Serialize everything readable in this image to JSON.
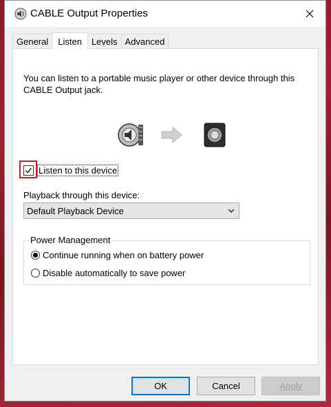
{
  "window": {
    "title": "CABLE Output Properties",
    "icon": "speaker-icon"
  },
  "tabs": [
    {
      "label": "General",
      "active": false
    },
    {
      "label": "Listen",
      "active": true
    },
    {
      "label": "Levels",
      "active": false
    },
    {
      "label": "Advanced",
      "active": false
    }
  ],
  "listen": {
    "description": "You can listen to a portable music player or other device through this CABLE Output jack.",
    "listen_checkbox_label": "Listen to this device",
    "listen_checked": true,
    "playback_label": "Playback through this device:",
    "playback_device": "Default Playback Device"
  },
  "power": {
    "title": "Power Management",
    "options": [
      {
        "label": "Continue running when on battery power",
        "selected": true
      },
      {
        "label": "Disable automatically to save power",
        "selected": false
      }
    ]
  },
  "buttons": {
    "ok": "OK",
    "cancel": "Cancel",
    "apply": "Apply"
  },
  "colors": {
    "highlight": "#e0191b",
    "default_button_border": "#0078d7"
  }
}
